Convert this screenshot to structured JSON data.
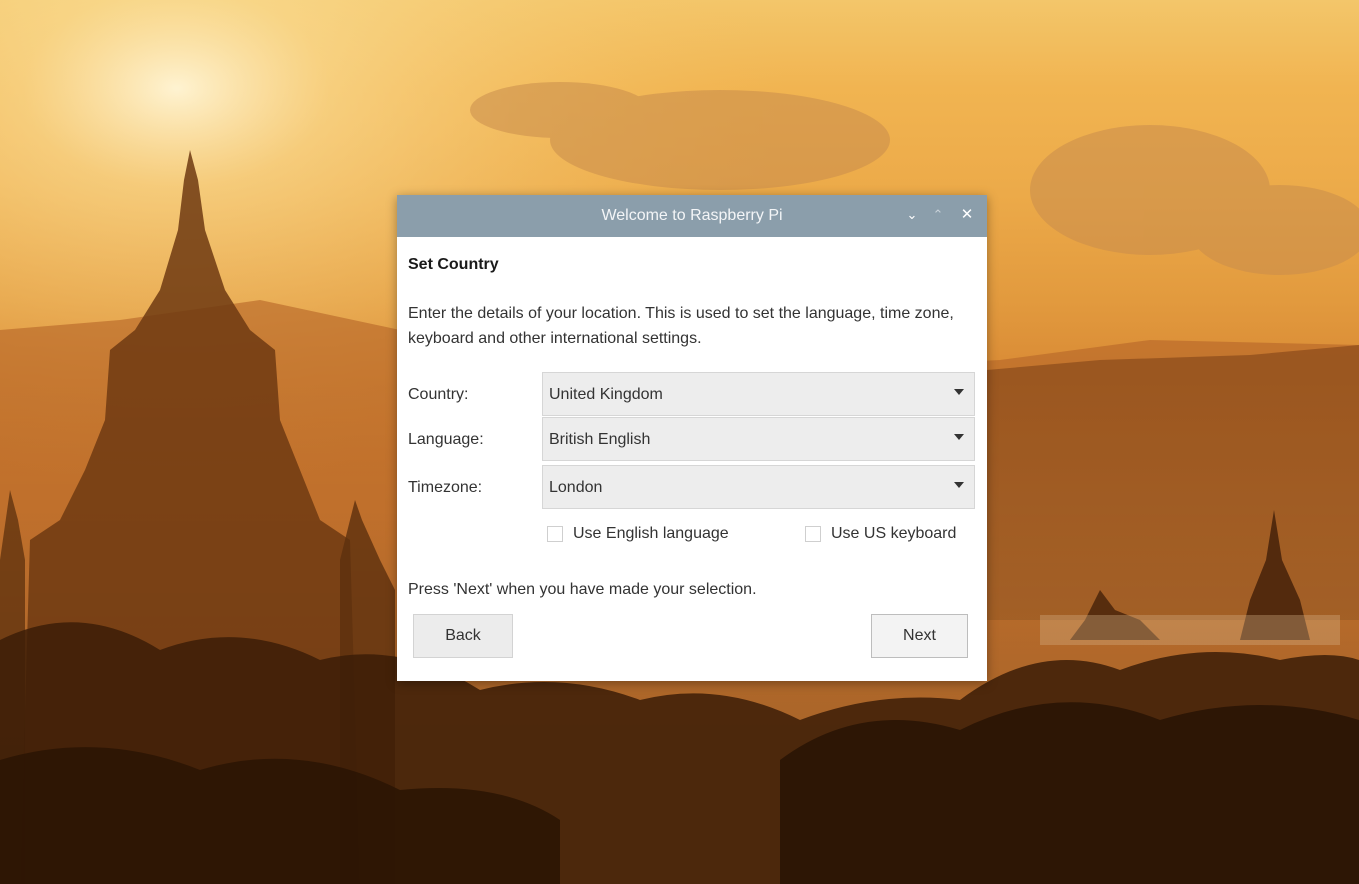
{
  "window": {
    "title": "Welcome to Raspberry Pi",
    "controls": {
      "minimize_icon": "chevron-down-icon",
      "maximize_icon": "chevron-up-icon",
      "close_icon": "close-icon"
    }
  },
  "page": {
    "heading": "Set Country",
    "description": "Enter the details of your location. This is used to set the language, time zone, keyboard and other international settings."
  },
  "form": {
    "country": {
      "label": "Country:",
      "value": "United Kingdom"
    },
    "language": {
      "label": "Language:",
      "value": "British English"
    },
    "timezone": {
      "label": "Timezone:",
      "value": "London"
    },
    "use_english": {
      "label": "Use English language",
      "checked": false
    },
    "use_us_keyboard": {
      "label": "Use US keyboard",
      "checked": false
    }
  },
  "footer": {
    "hint": "Press 'Next' when you have made your selection.",
    "back_label": "Back",
    "next_label": "Next"
  },
  "colors": {
    "titlebar": "#8b9eab",
    "window_bg": "#ffffff",
    "combo_bg": "#ededed"
  }
}
